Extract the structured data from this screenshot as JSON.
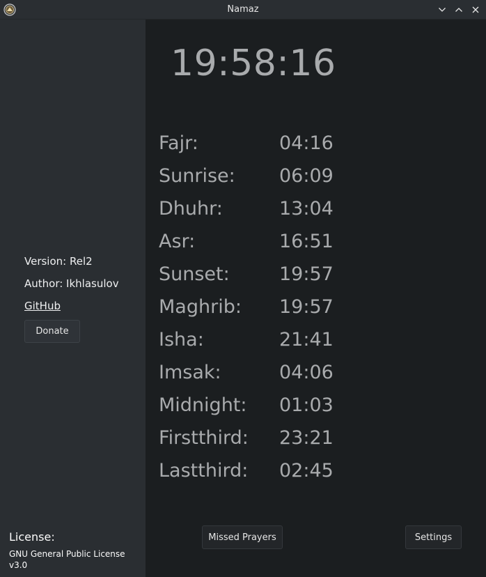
{
  "window": {
    "title": "Namaz",
    "icon": "namaz-app-icon",
    "controls": [
      "minimize",
      "maximize",
      "close"
    ]
  },
  "sidebar": {
    "version": "Version: Rel2",
    "author": "Author: Ikhlasulov",
    "github_link": "GitHub",
    "donate_button": "Donate",
    "license_label": "License:",
    "license_value": "GNU General Public License v3.0"
  },
  "main": {
    "current_time": "19:58:16",
    "prayer_times": [
      {
        "name": "Fajr:",
        "time": "04:16"
      },
      {
        "name": "Sunrise:",
        "time": "06:09"
      },
      {
        "name": "Dhuhr:",
        "time": "13:04"
      },
      {
        "name": "Asr:",
        "time": "16:51"
      },
      {
        "name": "Sunset:",
        "time": "19:57"
      },
      {
        "name": "Maghrib:",
        "time": "19:57"
      },
      {
        "name": "Isha:",
        "time": "21:41"
      },
      {
        "name": "Imsak:",
        "time": "04:06"
      },
      {
        "name": "Midnight:",
        "time": "01:03"
      },
      {
        "name": "Firstthird:",
        "time": "23:21"
      },
      {
        "name": "Lastthird:",
        "time": "02:45"
      }
    ],
    "missed_prayers_button": "Missed Prayers",
    "settings_button": "Settings"
  },
  "colors": {
    "sidebar_bg": "#2a2e32",
    "main_bg": "#1b1e20",
    "text_muted": "#a9abad",
    "text": "#fcfcfc"
  }
}
